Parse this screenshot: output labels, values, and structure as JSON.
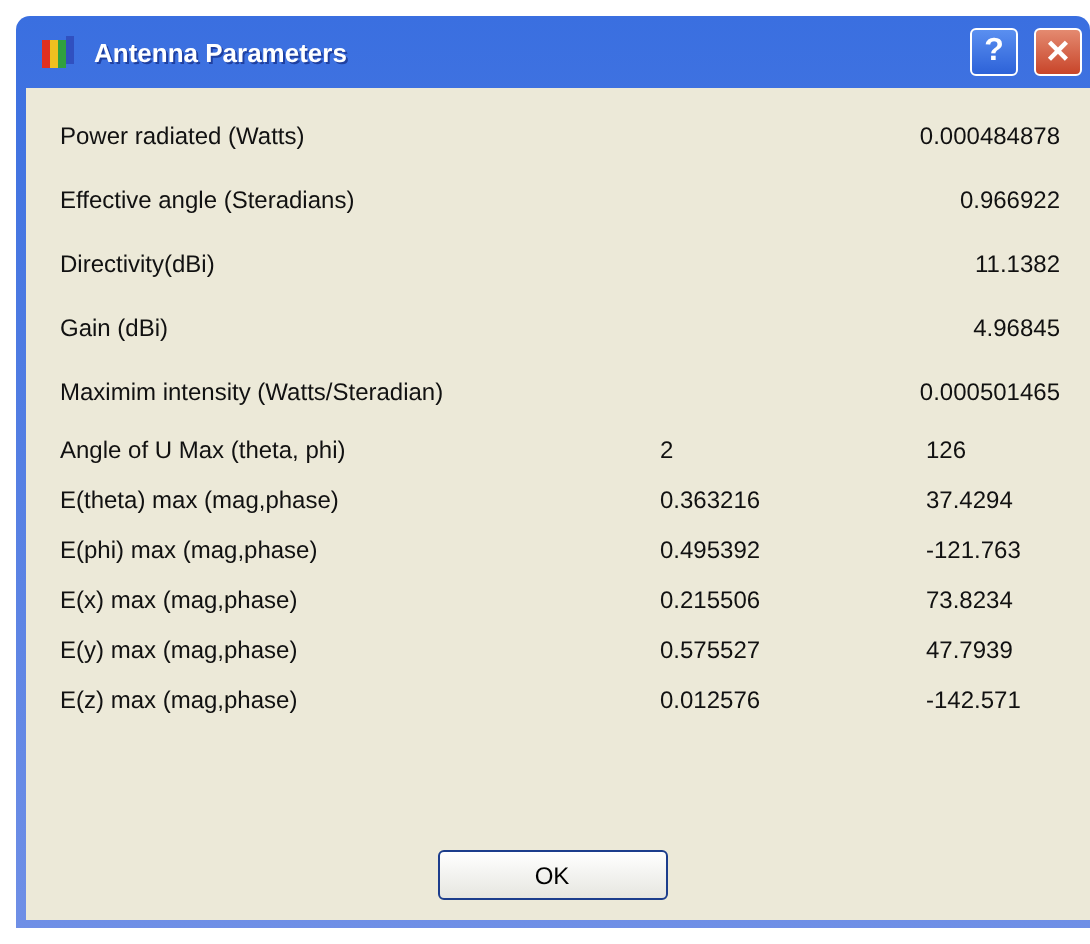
{
  "window": {
    "title": "Antenna Parameters",
    "buttons": [
      "?",
      "×"
    ]
  },
  "rows": [
    {
      "label": "Power radiated (Watts)",
      "values": [
        "0.000484878"
      ]
    },
    {
      "label": "Effective angle (Steradians)",
      "values": [
        "0.966922"
      ]
    },
    {
      "label": "Directivity(dBi)",
      "values": [
        "11.1382"
      ]
    },
    {
      "label": "Gain (dBi)",
      "values": [
        "4.96845"
      ]
    },
    {
      "label": "Maximim intensity (Watts/Steradian)",
      "values": [
        "0.000501465"
      ]
    },
    {
      "label": "Angle of U Max (theta, phi)",
      "values": [
        "2",
        "126"
      ]
    },
    {
      "label": "E(theta) max (mag,phase)",
      "values": [
        "0.363216",
        "37.4294"
      ]
    },
    {
      "label": "E(phi) max (mag,phase)",
      "values": [
        "0.495392",
        "-121.763"
      ]
    },
    {
      "label": "E(x) max (mag,phase)",
      "values": [
        "0.215506",
        "73.8234"
      ]
    },
    {
      "label": "E(y) max (mag,phase)",
      "values": [
        "0.575527",
        "47.7939"
      ]
    },
    {
      "label": "E(z) max (mag,phase)",
      "values": [
        "0.012576",
        "-142.571"
      ]
    }
  ],
  "ok_button": "OK"
}
